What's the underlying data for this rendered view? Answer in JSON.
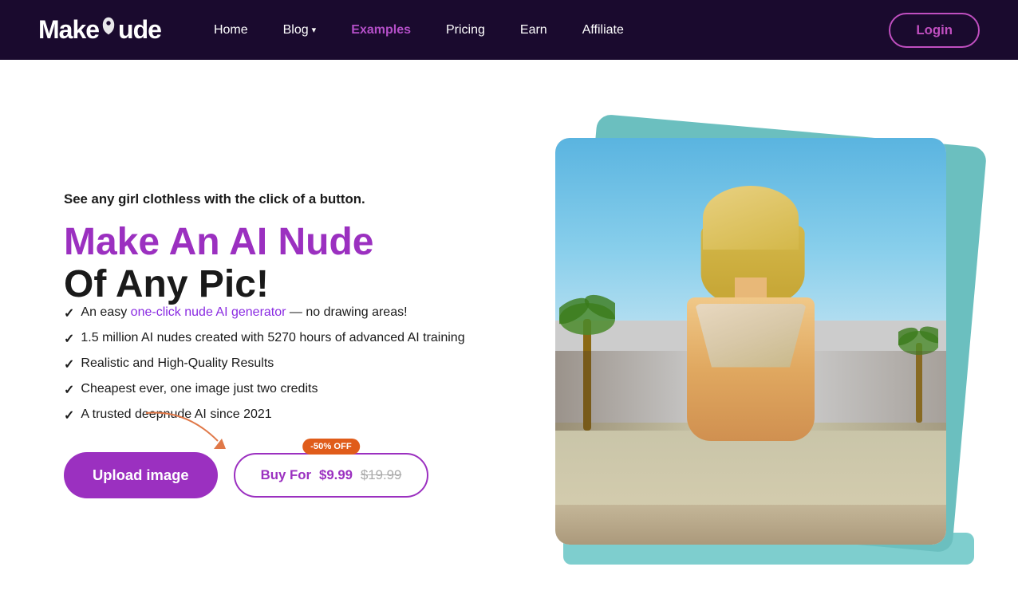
{
  "nav": {
    "logo": "MakeNude",
    "links": [
      {
        "label": "Home",
        "active": false
      },
      {
        "label": "Blog",
        "active": false,
        "hasDropdown": true
      },
      {
        "label": "Examples",
        "active": true
      },
      {
        "label": "Pricing",
        "active": false
      },
      {
        "label": "Earn",
        "active": false
      },
      {
        "label": "Affiliate",
        "active": false
      }
    ],
    "login_label": "Login"
  },
  "hero": {
    "subtitle": "See any girl clothless with the click of a button.",
    "title_line1": "Make An AI Nude",
    "title_line2": "Of Any Pic!",
    "features": [
      "An easy one-click nude AI generator — no drawing areas!",
      "1.5 million AI nudes created with 5270 hours of advanced AI training",
      "Realistic and High-Quality Results",
      "Cheapest ever, one image just two credits",
      "A trusted deepnude AI since 2021"
    ],
    "upload_button": "Upload image",
    "buy_button_prefix": "Buy For",
    "buy_price": "$9.99",
    "buy_old_price": "$19.99",
    "discount_badge": "-50% OFF"
  }
}
